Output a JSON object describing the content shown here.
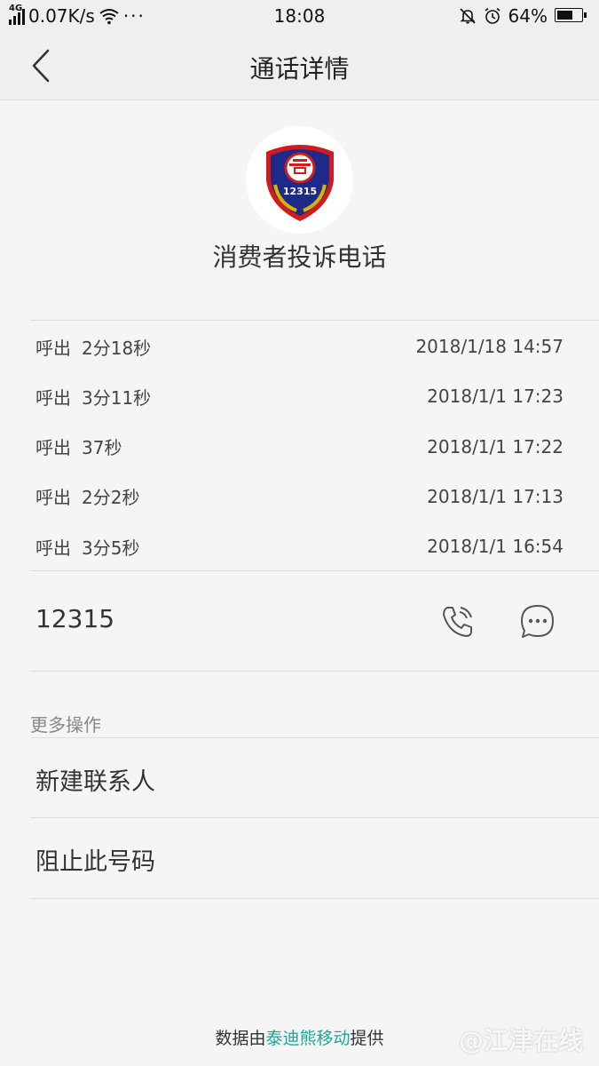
{
  "status_bar": {
    "network": "4G",
    "speed": "0.07K/s",
    "more": "···",
    "time": "18:08",
    "battery_percent": "64%",
    "battery_level": 0.64
  },
  "header": {
    "title": "通话详情"
  },
  "contact": {
    "name": "消费者投诉电话",
    "logo_text": "12315",
    "number": "12315"
  },
  "calls": [
    {
      "type": "呼出",
      "duration": "2分18秒",
      "datetime": "2018/1/18 14:57"
    },
    {
      "type": "呼出",
      "duration": "3分11秒",
      "datetime": "2018/1/1 17:23"
    },
    {
      "type": "呼出",
      "duration": "37秒",
      "datetime": "2018/1/1 17:22"
    },
    {
      "type": "呼出",
      "duration": "2分2秒",
      "datetime": "2018/1/1 17:13"
    },
    {
      "type": "呼出",
      "duration": "3分5秒",
      "datetime": "2018/1/1 16:54"
    }
  ],
  "more": {
    "title": "更多操作",
    "new_contact": "新建联系人",
    "block_number": "阻止此号码"
  },
  "footer": {
    "prefix": "数据由",
    "provider": "泰迪熊移动",
    "suffix": "提供"
  },
  "watermark": "@江津在线",
  "colors": {
    "accent": "#19a89a",
    "badge_blue": "#1e2a8a",
    "badge_red": "#d01c1c",
    "badge_gold": "#d8b400"
  }
}
